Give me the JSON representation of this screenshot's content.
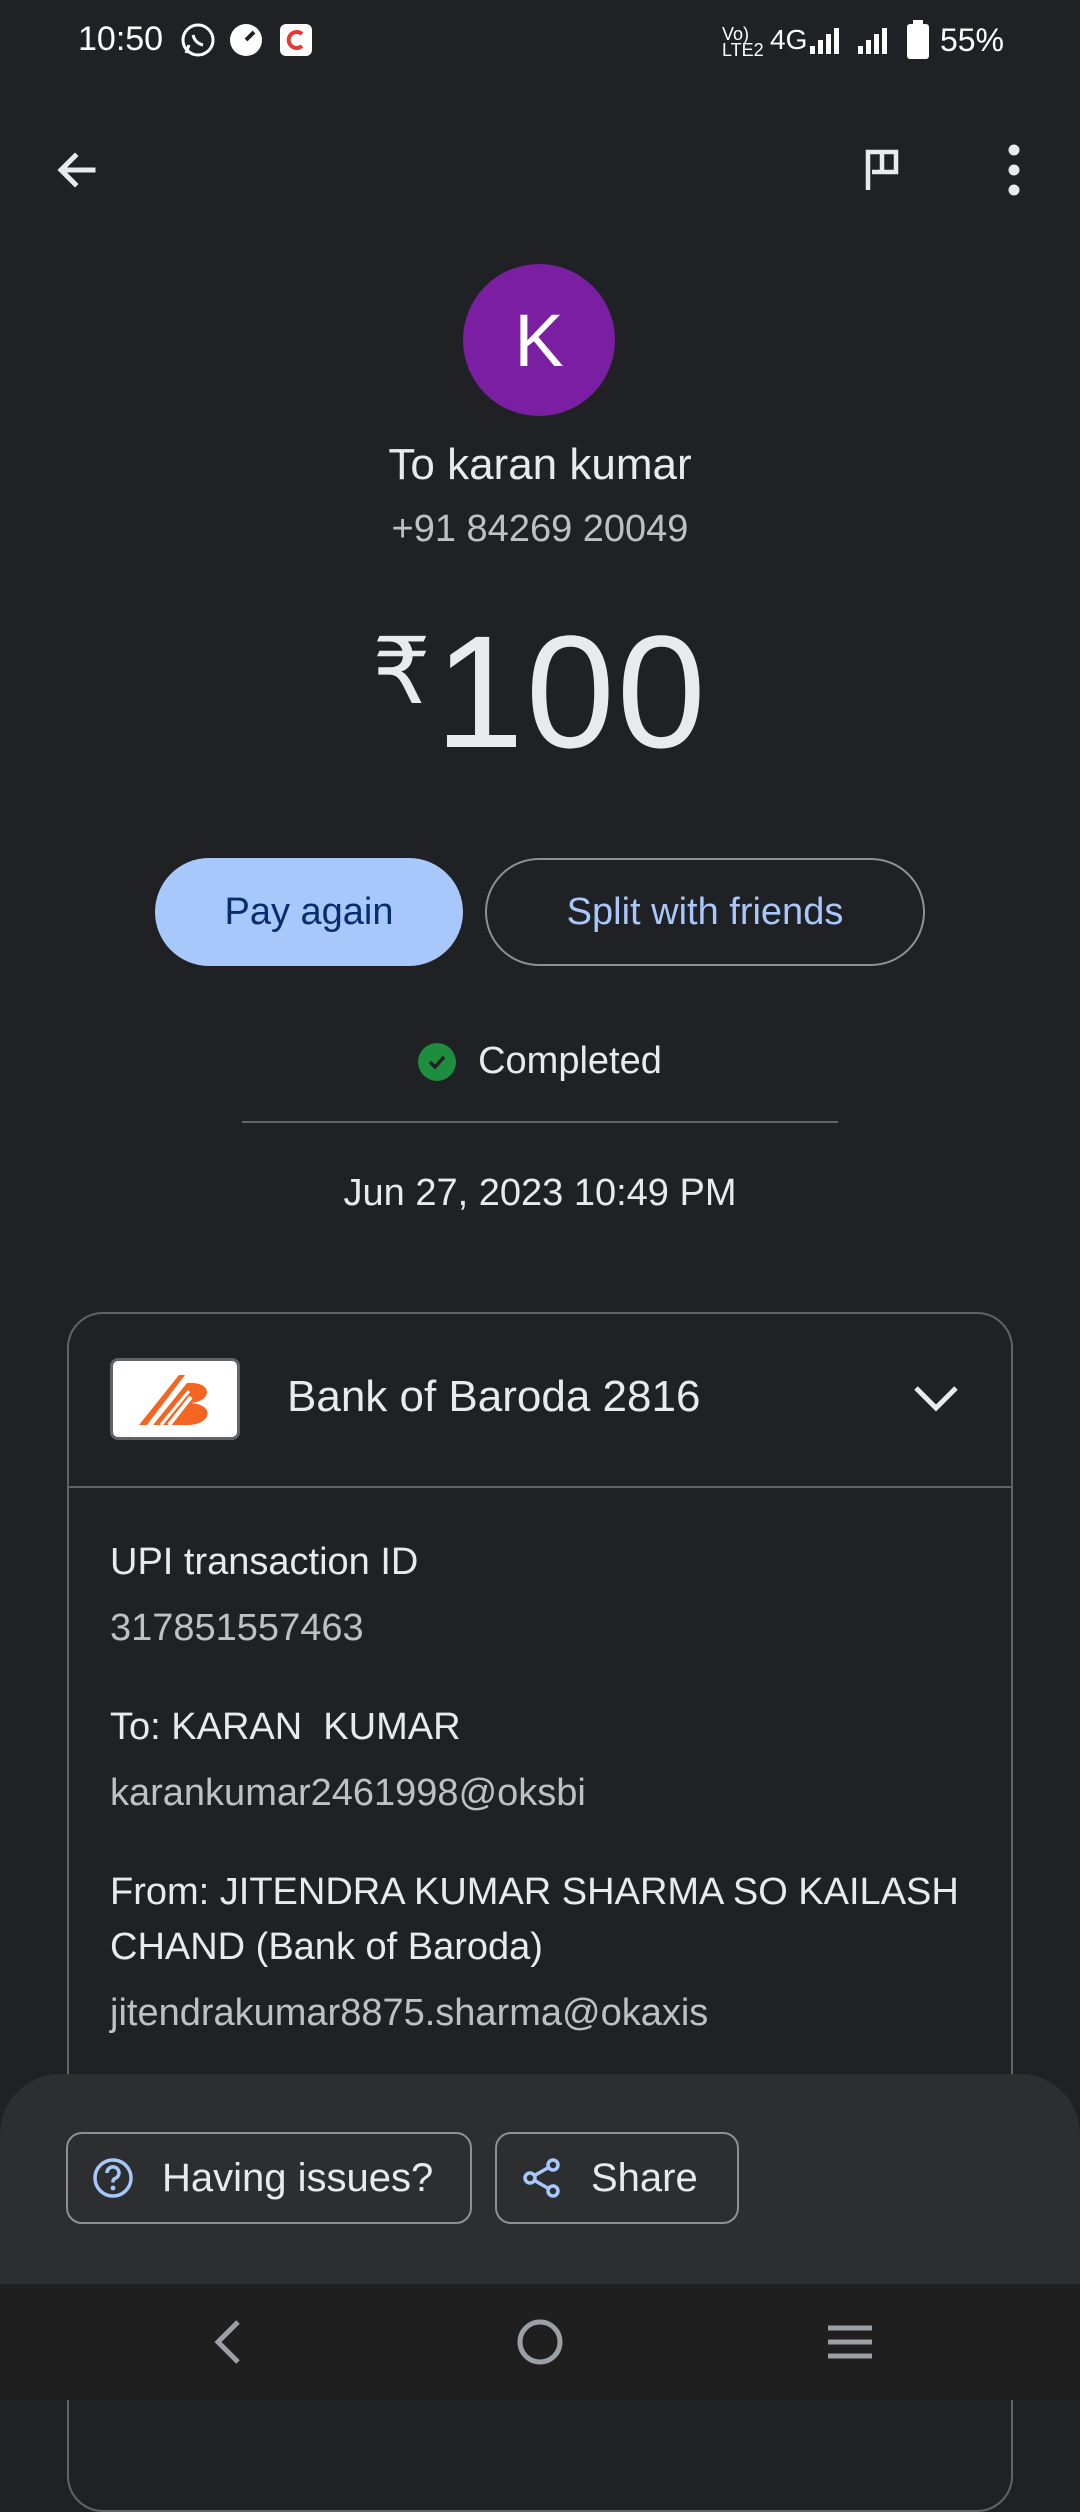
{
  "status_bar": {
    "time": "10:50",
    "network_label": "4G",
    "battery": "55%"
  },
  "top_bar": {
    "back_icon": "arrow-left-icon",
    "report_icon": "flag-icon",
    "menu_icon": "more-vert-icon"
  },
  "recipient": {
    "initial": "K",
    "avatar_color": "#7b1fa2",
    "name": "To karan kumar",
    "phone": "+91 84269 20049"
  },
  "payment": {
    "currency": "₹",
    "amount": "100",
    "status": "Completed",
    "datetime": "Jun 27, 2023 10:49 PM"
  },
  "actions": {
    "pay_again": "Pay again",
    "split": "Split with friends"
  },
  "details": {
    "bank_name": "Bank of Baroda 2816",
    "upi_id_label": "UPI transaction ID",
    "upi_id_value": "317851557463",
    "to_label": "To: KARAN  KUMAR",
    "to_value": "karankumar2461998@oksbi",
    "from_label_line1": "From: JITENDRA KUMAR SHARMA SO KAILASH",
    "from_label_line2": "CHAND (Bank of Baroda)",
    "from_value": "jitendrakumar8875.sharma@okaxis"
  },
  "bottom_sheet": {
    "issues": "Having issues?",
    "share": "Share"
  },
  "colors": {
    "background": "#202124",
    "accent": "#a8c7fa",
    "success": "#1e8e3e",
    "bank_brand": "#f26522"
  }
}
